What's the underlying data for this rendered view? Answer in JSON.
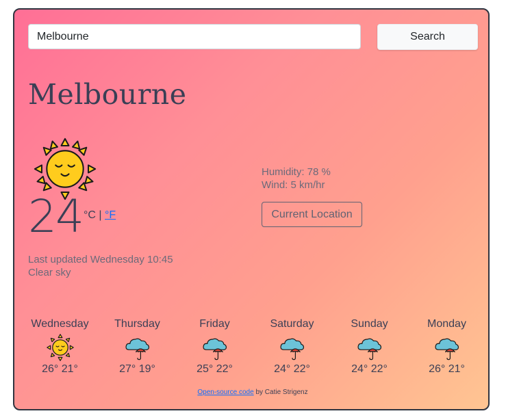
{
  "search": {
    "value": "Melbourne",
    "placeholder": "",
    "button_label": "Search"
  },
  "current": {
    "city": "Melbourne",
    "temperature": "24",
    "unit_celsius": "°C",
    "unit_separator": "|",
    "unit_fahrenheit": "°F",
    "last_updated": "Last updated Wednesday 10:45",
    "description": "Clear sky",
    "humidity": "Humidity: 78 %",
    "wind": "Wind: 5 km/hr",
    "icon": "sun-icon"
  },
  "location_button_label": "Current Location",
  "forecast": [
    {
      "day": "Wednesday",
      "temps": "26° 21°",
      "icon": "sun-icon"
    },
    {
      "day": "Thursday",
      "temps": "27° 19°",
      "icon": "cloud-umbrella-icon"
    },
    {
      "day": "Friday",
      "temps": "25° 22°",
      "icon": "cloud-umbrella-icon"
    },
    {
      "day": "Saturday",
      "temps": "24° 22°",
      "icon": "cloud-umbrella-icon"
    },
    {
      "day": "Sunday",
      "temps": "24° 22°",
      "icon": "cloud-umbrella-icon"
    },
    {
      "day": "Monday",
      "temps": "26° 21°",
      "icon": "cloud-umbrella-icon"
    }
  ],
  "footer": {
    "link_text": "Open-source code",
    "author_text": "by Catie Strigenz"
  },
  "colors": {
    "gradient_start": "#ff6f96",
    "gradient_end": "#ffc592",
    "link": "#0d6efd",
    "text": "#3a3f55"
  }
}
